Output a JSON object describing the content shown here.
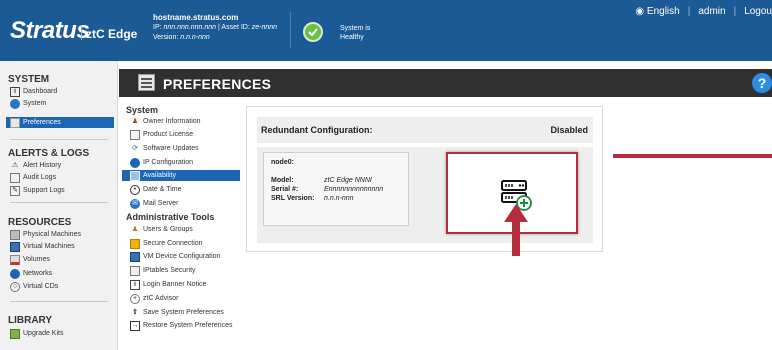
{
  "header": {
    "logo": "Stratus",
    "logo_sub": "ztC Edge",
    "hostname": "hostname.stratus.com",
    "ip_prefix": "IP: ",
    "ip_value": "nnn.nnn.nnn.nnn",
    "asset_sep": " | Asset ID: ",
    "asset_value": "ze-nnnn",
    "version_prefix": "Version: ",
    "version_value": "n.n.n-nnn",
    "status_line1": "System is",
    "status_line2": "Healthy",
    "language": "English",
    "user": "admin",
    "logout": "Logou"
  },
  "sidebar": {
    "system_title": "SYSTEM",
    "system_items": [
      {
        "label": "Dashboard"
      },
      {
        "label": "System"
      },
      {
        "label": "Preferences"
      }
    ],
    "alerts_title": "ALERTS & LOGS",
    "alerts_items": [
      {
        "label": "Alert History"
      },
      {
        "label": "Audit Logs"
      },
      {
        "label": "Support Logs"
      }
    ],
    "resources_title": "RESOURCES",
    "resources_items": [
      {
        "label": "Physical Machines"
      },
      {
        "label": "Virtual Machines"
      },
      {
        "label": "Volumes"
      },
      {
        "label": "Networks"
      },
      {
        "label": "Virtual CDs"
      }
    ],
    "library_title": "LIBRARY",
    "library_items": [
      {
        "label": "Upgrade Kits"
      }
    ]
  },
  "page": {
    "title": "PREFERENCES"
  },
  "menu": {
    "system_title": "System",
    "system_items": [
      {
        "label": "Owner Information"
      },
      {
        "label": "Product License"
      },
      {
        "label": "Software Updates"
      },
      {
        "label": "IP Configuration"
      },
      {
        "label": "Availability"
      },
      {
        "label": "Date & Time"
      },
      {
        "label": "Mail Server"
      }
    ],
    "admin_title": "Administrative Tools",
    "admin_items": [
      {
        "label": "Users & Groups"
      },
      {
        "label": "Secure Connection"
      },
      {
        "label": "VM Device Configuration"
      },
      {
        "label": "IPtables Security"
      },
      {
        "label": "Login Banner Notice"
      },
      {
        "label": "ztC Advisor"
      },
      {
        "label": "Save System Preferences"
      },
      {
        "label": "Restore System Preferences"
      }
    ]
  },
  "panel": {
    "title": "Redundant Configuration:",
    "status": "Disabled",
    "node": {
      "name": "node0:",
      "model_label": "Model:",
      "model_value": "ztC Edge NNNI",
      "serial_label": "Serial #:",
      "serial_value": "Ennnnnnnnnnnnnn",
      "srl_label": "SRL Version:",
      "srl_value": "n.n.n-nnn"
    }
  },
  "colors": {
    "header_bg": "#1b5a94",
    "active_bg": "#1d66b4",
    "page_bar": "#303030",
    "annotation": "#b52d3d",
    "healthy": "#6cc04a"
  }
}
